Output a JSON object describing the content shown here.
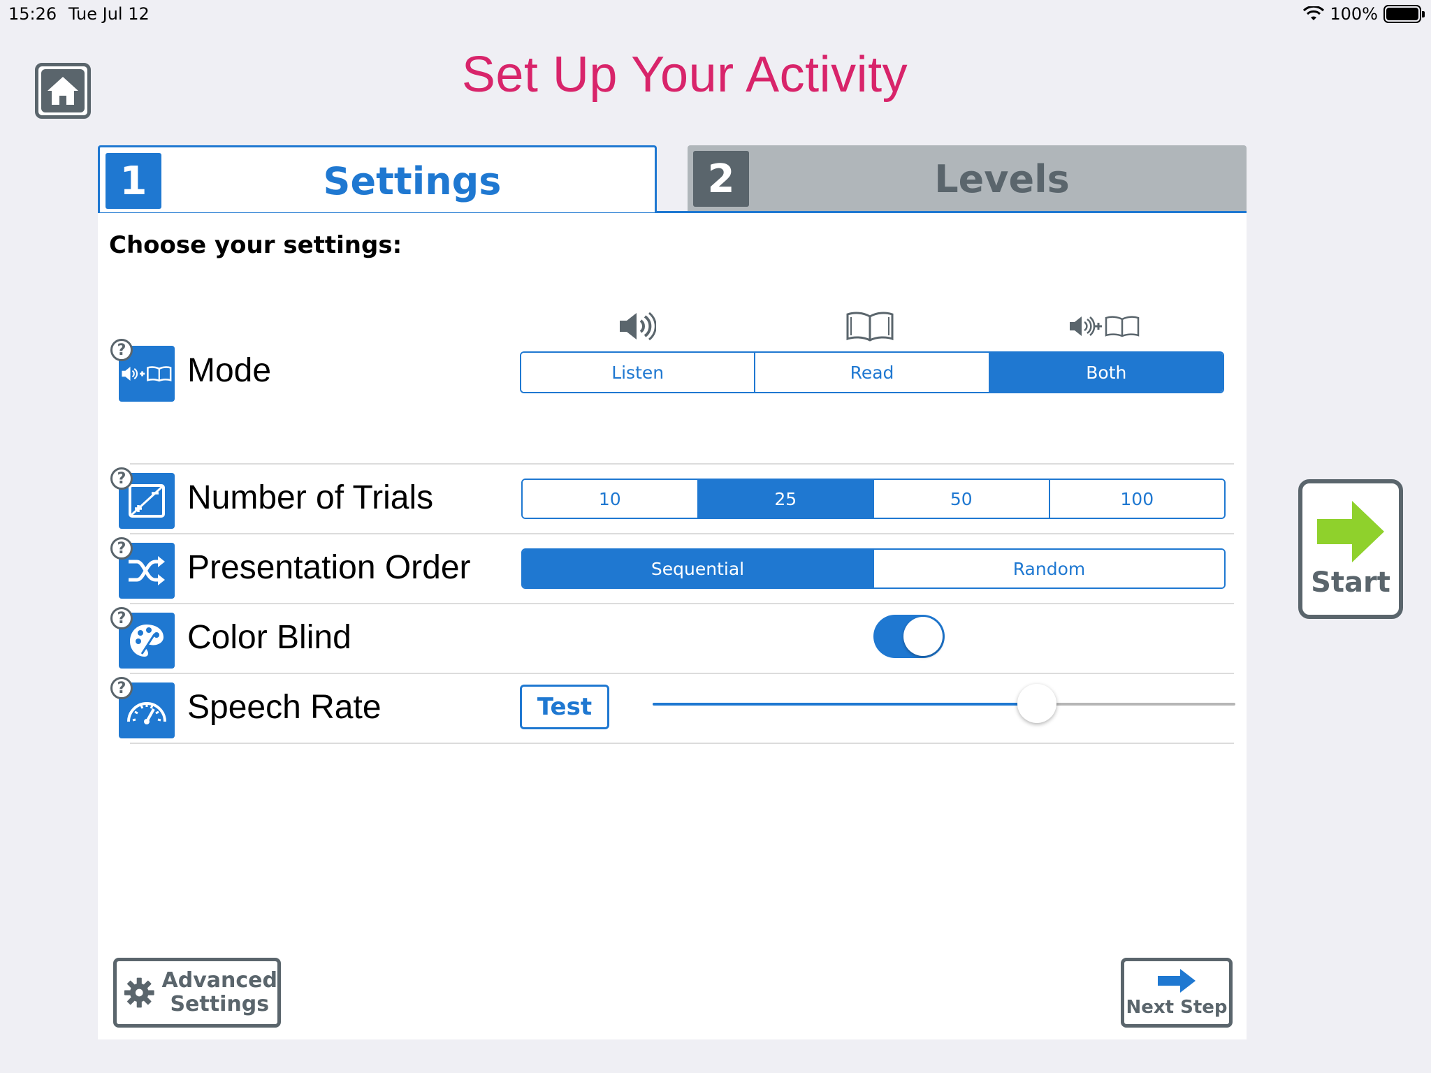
{
  "status_bar": {
    "time": "15:26",
    "date": "Tue Jul 12",
    "battery": "100%"
  },
  "page_title": "Set Up Your Activity",
  "tabs": [
    {
      "number": "1",
      "label": "Settings",
      "active": true
    },
    {
      "number": "2",
      "label": "Levels",
      "active": false
    }
  ],
  "panel": {
    "subtitle": "Choose your settings:",
    "mode": {
      "label": "Mode",
      "options": [
        "Listen",
        "Read",
        "Both"
      ],
      "selected": "Both"
    },
    "trials": {
      "label": "Number of Trials",
      "options": [
        "10",
        "25",
        "50",
        "100"
      ],
      "selected": "25"
    },
    "order": {
      "label": "Presentation Order",
      "options": [
        "Sequential",
        "Random"
      ],
      "selected": "Sequential"
    },
    "color_blind": {
      "label": "Color Blind",
      "on": true
    },
    "speech_rate": {
      "label": "Speech Rate",
      "test_label": "Test",
      "value_fraction": 0.66
    },
    "help_glyph": "?"
  },
  "advanced_settings": {
    "line1": "Advanced",
    "line2": "Settings"
  },
  "next_step": {
    "label": "Next Step"
  },
  "start": {
    "label": "Start"
  },
  "colors": {
    "accent": "#1f78d1",
    "title": "#d8246a",
    "gray": "#5a656c",
    "start_arrow": "#8fd12c"
  }
}
